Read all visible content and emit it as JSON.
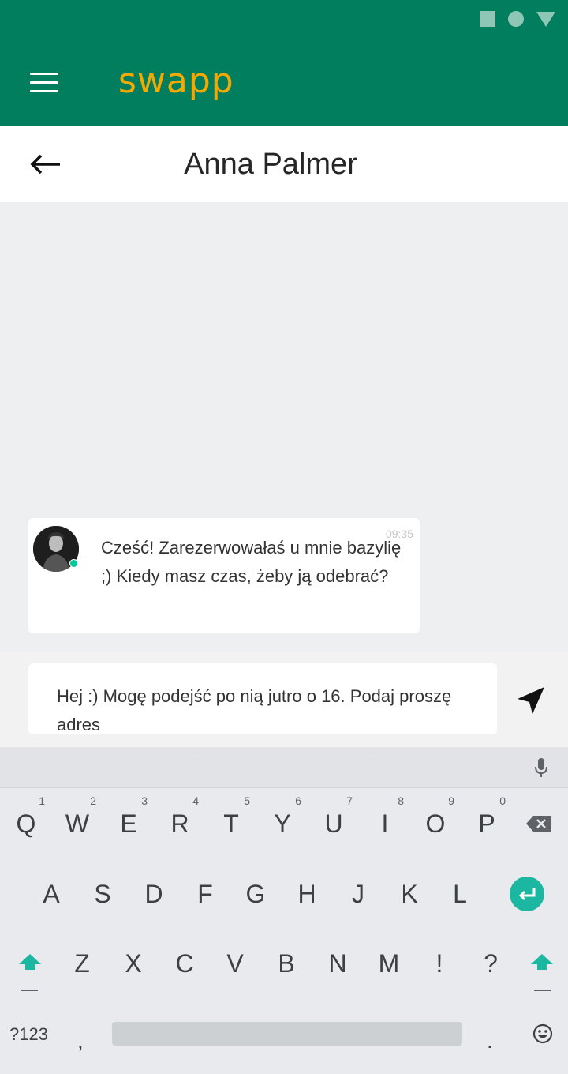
{
  "app": {
    "logo": "swapp"
  },
  "header": {
    "title": "Anna Palmer"
  },
  "messages": [
    {
      "time": "09:35",
      "text": "Cześć! Zarezerwowałaś u mnie bazylię ;) Kiedy masz czas, żeby ją odebrać?"
    }
  ],
  "composer": {
    "value": "Hej :) Mogę podejść po nią jutro o 16. Podaj proszę adres"
  },
  "keyboard": {
    "row1": [
      {
        "k": "Q",
        "h": "1"
      },
      {
        "k": "W",
        "h": "2"
      },
      {
        "k": "E",
        "h": "3"
      },
      {
        "k": "R",
        "h": "4"
      },
      {
        "k": "T",
        "h": "5"
      },
      {
        "k": "Y",
        "h": "6"
      },
      {
        "k": "U",
        "h": "7"
      },
      {
        "k": "I",
        "h": "8"
      },
      {
        "k": "O",
        "h": "9"
      },
      {
        "k": "P",
        "h": "0"
      }
    ],
    "row2": [
      "A",
      "S",
      "D",
      "F",
      "G",
      "H",
      "J",
      "K",
      "L"
    ],
    "row3": [
      "Z",
      "X",
      "C",
      "V",
      "B",
      "N",
      "M",
      "!",
      "?"
    ],
    "symbols_label": "?123",
    "comma": ",",
    "period": "."
  },
  "colors": {
    "primary": "#007e5e",
    "logo": "#f5a800",
    "accent": "#1bb7a0",
    "online": "#00c897"
  }
}
